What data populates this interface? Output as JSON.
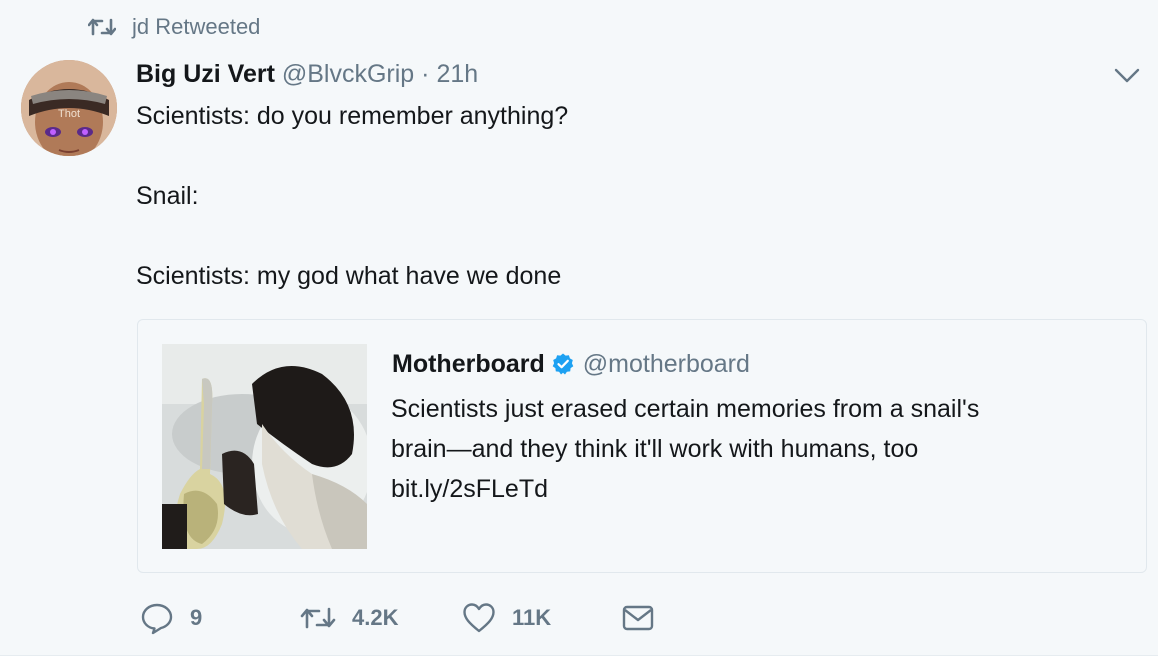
{
  "retweet_context": {
    "icon": "retweet-icon",
    "label": "jd Retweeted"
  },
  "tweet": {
    "author_name": "Big Uzi Vert",
    "author_handle": "@BlvckGrip",
    "separator": "·",
    "time": "21h",
    "avatar_label": "Thot",
    "lines": [
      "Scientists: do you remember anything?",
      "",
      "Snail:",
      "",
      "Scientists: my god what have we done"
    ]
  },
  "quoted_tweet": {
    "author_name": "Motherboard",
    "verified": true,
    "author_handle": "@motherboard",
    "lines": [
      "Scientists just erased certain memories from a snail's",
      "brain—and they think it'll work with humans, too",
      "bit.ly/2sFLeTd"
    ]
  },
  "actions": {
    "reply_count": "9",
    "retweet_count": "4.2K",
    "like_count": "11K",
    "icons": [
      "reply-icon",
      "retweet-icon",
      "like-icon",
      "message-icon"
    ]
  },
  "colors": {
    "background": "#f5f8fa",
    "secondary_text": "#657786",
    "verified_blue": "#1da1f2",
    "border": "#e1e8ed"
  }
}
